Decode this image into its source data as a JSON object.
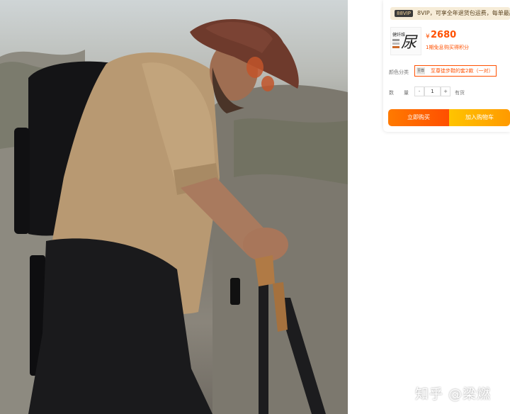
{
  "product_image": {
    "alt": ""
  },
  "vip_banner": {
    "badge": "88VIP",
    "text": "8VIP，可享全年退货包运费，每单最高!"
  },
  "thumbnail": {
    "brand": "健纤维",
    "signature": "尿"
  },
  "price": {
    "symbol": "¥",
    "amount": "2680",
    "monthly_sales": "1期免息",
    "points": "购买得积分"
  },
  "options": {
    "color_label": "颜色分类",
    "color_swatch_text": "至尊",
    "color_value": "至尊徒步鞋的套2款（一对）",
    "qty_label_1": "数",
    "qty_label_2": "量",
    "qty_minus": "-",
    "qty_value": "1",
    "qty_plus": "+",
    "stock": "有货"
  },
  "actions": {
    "buy_now": "立即购买",
    "add_to_cart": "加入购物车"
  },
  "watermark": "知乎 @梁燃",
  "colors": {
    "accent": "#ff5000",
    "buy_button": "#ff5a00",
    "cart_button": "#ffb000",
    "vip_strip": "#f6ecd8"
  }
}
